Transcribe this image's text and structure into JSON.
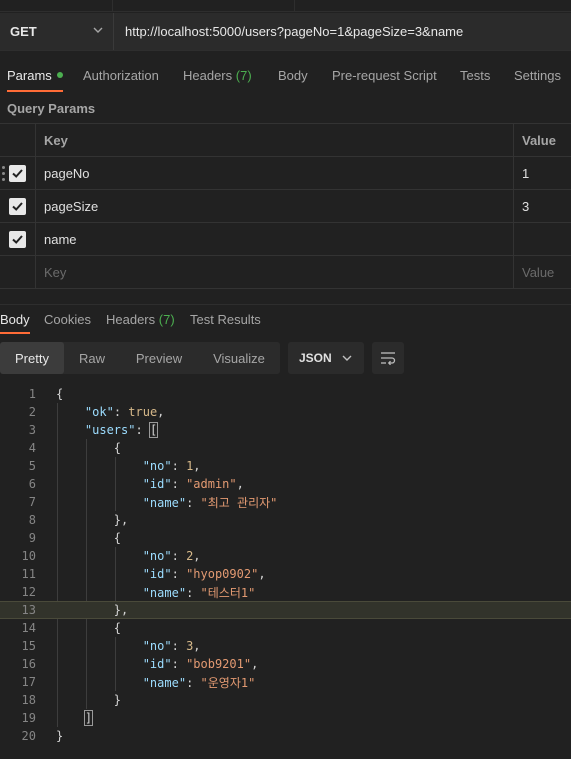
{
  "request": {
    "method": "GET",
    "url": "http://localhost:5000/users?pageNo=1&pageSize=3&name"
  },
  "request_tabs": [
    {
      "label": "Params",
      "active": true,
      "dot": true
    },
    {
      "label": "Authorization"
    },
    {
      "label": "Headers",
      "count": "(7)"
    },
    {
      "label": "Body"
    },
    {
      "label": "Pre-request Script"
    },
    {
      "label": "Tests"
    },
    {
      "label": "Settings"
    }
  ],
  "query_params": {
    "title": "Query Params",
    "headers": {
      "key": "Key",
      "value": "Value"
    },
    "rows": [
      {
        "key": "pageNo",
        "value": "1",
        "checked": true
      },
      {
        "key": "pageSize",
        "value": "3",
        "checked": true
      },
      {
        "key": "name",
        "value": "",
        "checked": true
      }
    ],
    "placeholder": {
      "key": "Key",
      "value": "Value"
    }
  },
  "response_tabs": [
    {
      "label": "Body",
      "active": true
    },
    {
      "label": "Cookies"
    },
    {
      "label": "Headers",
      "count": "(7)"
    },
    {
      "label": "Test Results"
    }
  ],
  "view_modes": [
    "Pretty",
    "Raw",
    "Preview",
    "Visualize"
  ],
  "active_view": "Pretty",
  "format": "JSON",
  "code_lines": [
    {
      "n": "1"
    },
    {
      "n": "2"
    },
    {
      "n": "3"
    },
    {
      "n": "4"
    },
    {
      "n": "5"
    },
    {
      "n": "6"
    },
    {
      "n": "7"
    },
    {
      "n": "8"
    },
    {
      "n": "9"
    },
    {
      "n": "10"
    },
    {
      "n": "11"
    },
    {
      "n": "12"
    },
    {
      "n": "13"
    },
    {
      "n": "14"
    },
    {
      "n": "15"
    },
    {
      "n": "16"
    },
    {
      "n": "17"
    },
    {
      "n": "18"
    },
    {
      "n": "19"
    },
    {
      "n": "20"
    }
  ],
  "json_body": {
    "ok_key": "\"ok\"",
    "ok_val": "true",
    "users_key": "\"users\"",
    "users": [
      {
        "no": "1",
        "id": "\"admin\"",
        "name": "\"최고 관리자\""
      },
      {
        "no": "2",
        "id": "\"hyop0902\"",
        "name": "\"테스터1\""
      },
      {
        "no": "3",
        "id": "\"bob9201\"",
        "name": "\"운영자1\""
      }
    ],
    "no_key": "\"no\"",
    "id_key": "\"id\"",
    "name_key": "\"name\""
  },
  "highlighted_line": "13",
  "colors": {
    "accent": "#ff6c37",
    "count": "#4caf50",
    "string": "#e39a72",
    "key": "#9cdcfe"
  }
}
